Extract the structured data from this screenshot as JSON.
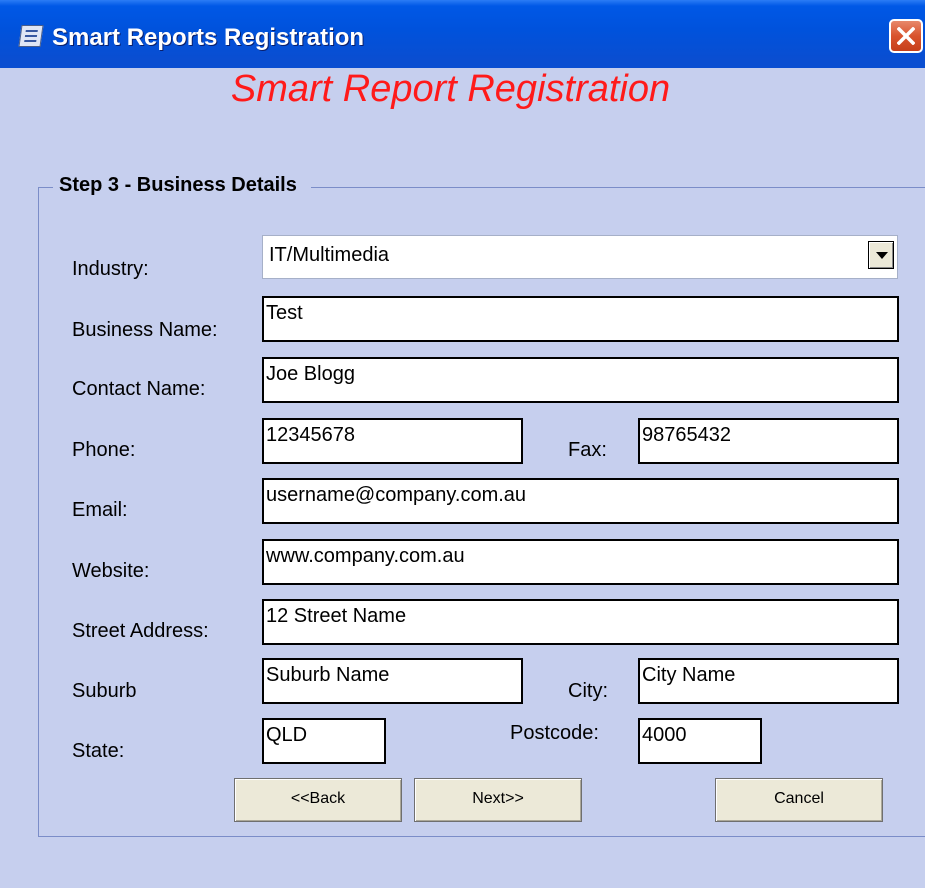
{
  "window": {
    "title": "Smart Reports Registration",
    "icon": "app-icon",
    "close_icon": "close-icon",
    "title_bar_color": "#0054e3",
    "background_color": "#c6cfee"
  },
  "heading": {
    "text": "Smart Report Registration",
    "color": "#ff1a1a"
  },
  "step": {
    "legend": "Step 3 - Business Details"
  },
  "form": {
    "industry": {
      "label": "Industry:",
      "value": "IT/Multimedia",
      "icon": "chevron-down-icon"
    },
    "business_name": {
      "label": "Business Name:",
      "value": "Test"
    },
    "contact_name": {
      "label": "Contact Name:",
      "value": "Joe Blogg"
    },
    "phone": {
      "label": "Phone:",
      "value": "12345678"
    },
    "fax": {
      "label": "Fax:",
      "value": "98765432"
    },
    "email": {
      "label": "Email:",
      "value": "username@company.com.au"
    },
    "website": {
      "label": "Website:",
      "value": "www.company.com.au"
    },
    "street_address": {
      "label": "Street Address:",
      "value": "12 Street Name"
    },
    "suburb": {
      "label": "Suburb",
      "value": "Suburb Name"
    },
    "city": {
      "label": "City:",
      "value": "City Name"
    },
    "state": {
      "label": "State:",
      "value": "QLD"
    },
    "postcode": {
      "label": "Postcode:",
      "value": "4000"
    }
  },
  "buttons": {
    "back": "<<Back",
    "next": "Next>>",
    "cancel": "Cancel"
  }
}
